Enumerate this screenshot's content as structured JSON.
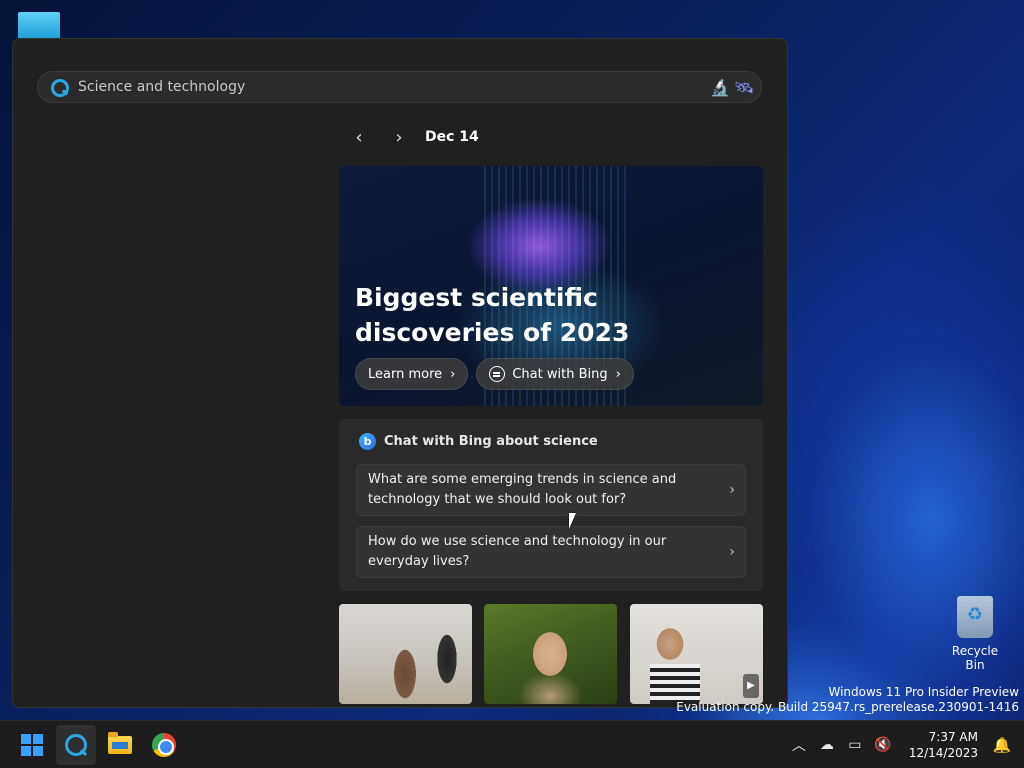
{
  "search": {
    "query": "Science and technology"
  },
  "date_nav": {
    "prev_icon": "chevron-left-icon",
    "next_icon": "chevron-right-icon",
    "prev_glyph": "‹",
    "next_glyph": "›",
    "date": "Dec 14"
  },
  "hero": {
    "title": "Biggest scientific discoveries of 2023",
    "learn_more": "Learn more",
    "chat_with_bing": "Chat with Bing"
  },
  "chat_card": {
    "heading": "Chat with Bing about science",
    "bing_glyph": "b",
    "suggestions": [
      {
        "text": "What are some emerging trends in science and technology that we should look out for?"
      },
      {
        "text": "How do we use science and technology in our everyday lives?"
      }
    ]
  },
  "watermark": {
    "line1": "Windows 11 Pro Insider Preview",
    "line2": "Evaluation copy. Build 25947.rs_prerelease.230901-1416"
  },
  "desktop": {
    "recycle_bin": "Recycle Bin"
  },
  "taskbar": {
    "time": "7:37 AM",
    "date": "12/14/2023"
  },
  "colors": {
    "accent": "#2aa8e0",
    "panel_bg": "#202020",
    "card_bg": "#2a2a2a"
  }
}
